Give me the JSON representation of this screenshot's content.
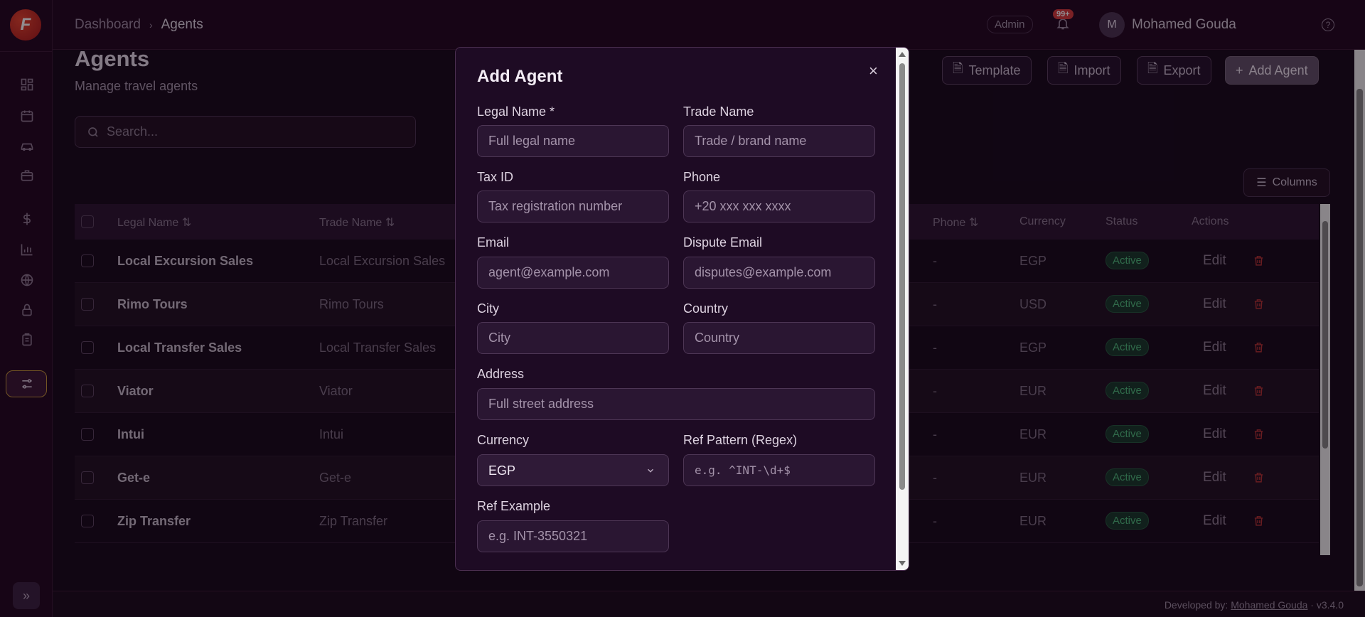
{
  "app": {
    "logo_letter": "F"
  },
  "breadcrumb": {
    "root": "Dashboard",
    "current": "Agents"
  },
  "header": {
    "role_badge": "Admin",
    "notifications_count": "99+",
    "avatar_initial": "M",
    "user_name": "Mohamed Gouda",
    "help": "?"
  },
  "page": {
    "title": "Agents",
    "subtitle": "Manage travel agents"
  },
  "search": {
    "placeholder": "Search..."
  },
  "toolbar": {
    "template": "Template",
    "import": "Import",
    "export": "Export",
    "add_agent": "Add Agent",
    "columns": "Columns"
  },
  "table": {
    "headers": {
      "legal_name": "Legal Name",
      "trade_name": "Trade Name",
      "phone": "Phone",
      "currency": "Currency",
      "status": "Status",
      "actions": "Actions"
    },
    "rows": [
      {
        "legal_name": "Local Excursion Sales",
        "trade_name": "Local Excursion Sales",
        "phone": "-",
        "currency": "EGP",
        "status": "Active",
        "edit": "Edit"
      },
      {
        "legal_name": "Rimo Tours",
        "trade_name": "Rimo Tours",
        "phone": "-",
        "currency": "USD",
        "status": "Active",
        "edit": "Edit"
      },
      {
        "legal_name": "Local Transfer Sales",
        "trade_name": "Local Transfer Sales",
        "phone": "-",
        "currency": "EGP",
        "status": "Active",
        "edit": "Edit"
      },
      {
        "legal_name": "Viator",
        "trade_name": "Viator",
        "phone": "-",
        "currency": "EUR",
        "status": "Active",
        "edit": "Edit"
      },
      {
        "legal_name": "Intui",
        "trade_name": "Intui",
        "phone": "-",
        "currency": "EUR",
        "status": "Active",
        "edit": "Edit"
      },
      {
        "legal_name": "Get-e",
        "trade_name": "Get-e",
        "phone": "-",
        "currency": "EUR",
        "status": "Active",
        "edit": "Edit"
      },
      {
        "legal_name": "Zip Transfer",
        "trade_name": "Zip Transfer",
        "phone": "-",
        "currency": "EUR",
        "status": "Active",
        "edit": "Edit"
      }
    ]
  },
  "modal": {
    "title": "Add Agent",
    "close": "×",
    "legal_name": {
      "label": "Legal Name *",
      "placeholder": "Full legal name"
    },
    "trade_name": {
      "label": "Trade Name",
      "placeholder": "Trade / brand name"
    },
    "tax_id": {
      "label": "Tax ID",
      "placeholder": "Tax registration number"
    },
    "phone": {
      "label": "Phone",
      "placeholder": "+20 xxx xxx xxxx"
    },
    "email": {
      "label": "Email",
      "placeholder": "agent@example.com"
    },
    "dispute_email": {
      "label": "Dispute Email",
      "placeholder": "disputes@example.com"
    },
    "city": {
      "label": "City",
      "placeholder": "City"
    },
    "country": {
      "label": "Country",
      "placeholder": "Country"
    },
    "address": {
      "label": "Address",
      "placeholder": "Full street address"
    },
    "currency": {
      "label": "Currency",
      "value": "EGP"
    },
    "ref_pattern": {
      "label": "Ref Pattern (Regex)",
      "placeholder": "e.g. ^INT-\\d+$"
    },
    "ref_example": {
      "label": "Ref Example",
      "placeholder": "e.g. INT-3550321"
    }
  },
  "footer": {
    "prefix": "Developed by:",
    "developer": "Mohamed Gouda",
    "version": "· v3.4.0"
  },
  "colors": {
    "accent": "#c99a3a",
    "danger": "#b83333",
    "success": "#4fbf7e",
    "brand": "#d8352a"
  }
}
